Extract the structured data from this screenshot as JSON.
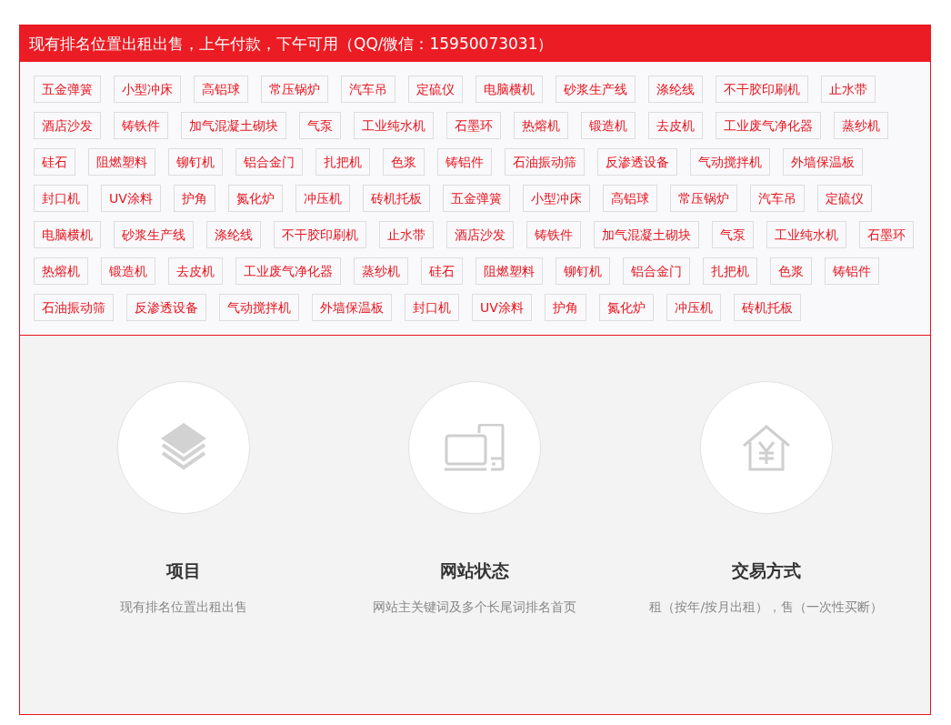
{
  "header": {
    "title": "现有排名位置出租出售，上午付款，下午可用（QQ/微信：15950073031）"
  },
  "tags": [
    "五金弹簧",
    "小型冲床",
    "高铝球",
    "常压锅炉",
    "汽车吊",
    "定硫仪",
    "电脑横机",
    "砂浆生产线",
    "涤纶线",
    "不干胶印刷机",
    "止水带",
    "酒店沙发",
    "铸铁件",
    "加气混凝土砌块",
    "气泵",
    "工业纯水机",
    "石墨环",
    "热熔机",
    "锻造机",
    "去皮机",
    "工业废气净化器",
    "蒸纱机",
    "硅石",
    "阻燃塑料",
    "铆钉机",
    "铝合金门",
    "扎把机",
    "色浆",
    "铸铝件",
    "石油振动筛",
    "反渗透设备",
    "气动搅拌机",
    "外墙保温板",
    "封口机",
    "UV涂料",
    "护角",
    "氮化炉",
    "冲压机",
    "砖机托板",
    "五金弹簧",
    "小型冲床",
    "高铝球",
    "常压锅炉",
    "汽车吊",
    "定硫仪",
    "电脑横机",
    "砂浆生产线",
    "涤纶线",
    "不干胶印刷机",
    "止水带",
    "酒店沙发",
    "铸铁件",
    "加气混凝土砌块",
    "气泵",
    "工业纯水机",
    "石墨环",
    "热熔机",
    "锻造机",
    "去皮机",
    "工业废气净化器",
    "蒸纱机",
    "硅石",
    "阻燃塑料",
    "铆钉机",
    "铝合金门",
    "扎把机",
    "色浆",
    "铸铝件",
    "石油振动筛",
    "反渗透设备",
    "气动搅拌机",
    "外墙保温板",
    "封口机",
    "UV涂料",
    "护角",
    "氮化炉",
    "冲压机",
    "砖机托板"
  ],
  "features": [
    {
      "kind": "layers",
      "title": "项目",
      "description": "现有排名位置出租出售"
    },
    {
      "kind": "devices",
      "title": "网站状态",
      "description": "网站主关键词及多个长尾词排名首页"
    },
    {
      "kind": "house",
      "title": "交易方式",
      "description": "租（按年/按月出租），售（一次性买断）"
    }
  ]
}
